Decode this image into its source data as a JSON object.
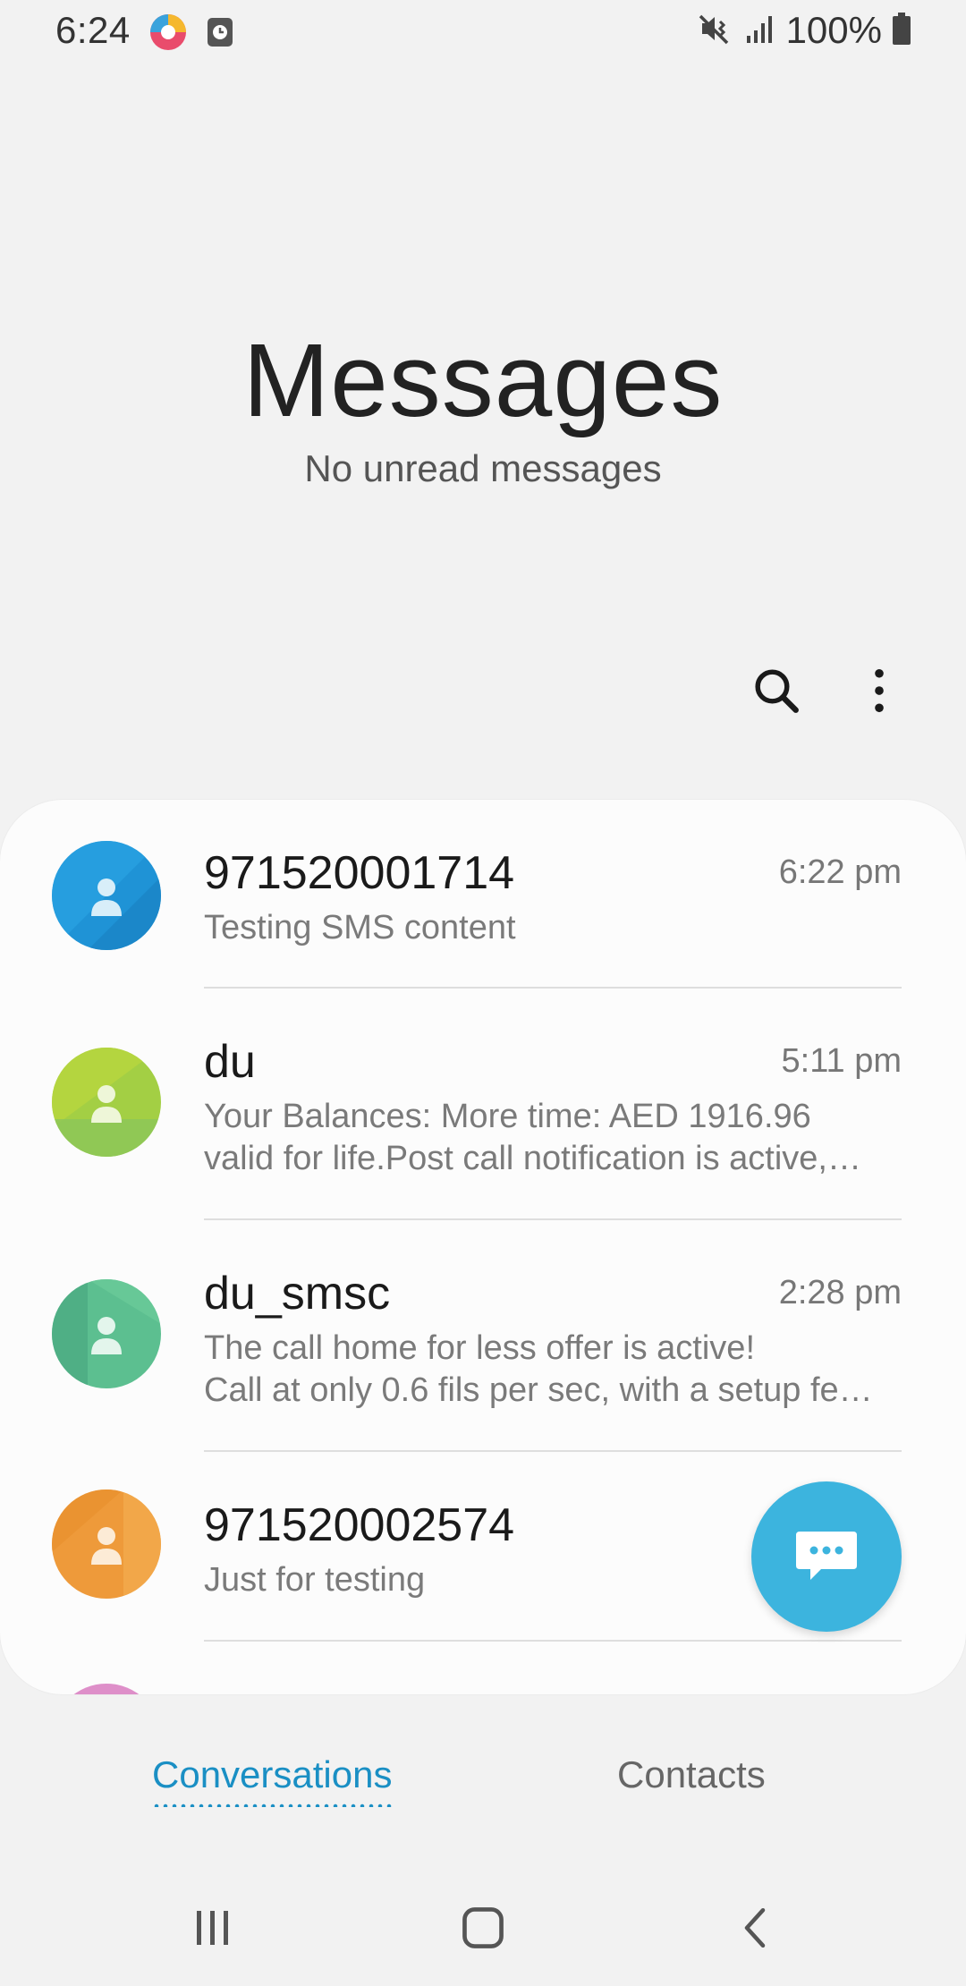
{
  "status_bar": {
    "time": "6:24",
    "battery_text": "100%",
    "icons": [
      "app-notification-icon",
      "clock-app-icon",
      "mute-vibrate-icon",
      "signal-icon",
      "battery-icon"
    ]
  },
  "header": {
    "title": "Messages",
    "subtitle": "No unread messages"
  },
  "toolbar": {
    "icons": [
      "search-icon",
      "more-options-icon"
    ]
  },
  "conversations": [
    {
      "name": "971520001714",
      "time": "6:22 pm",
      "preview_lines": [
        "Testing SMS content"
      ],
      "avatar_color": "#1f93d6"
    },
    {
      "name": "du",
      "time": "5:11 pm",
      "preview_lines": [
        "Your Balances: More time: AED 1916.96",
        "valid for life.Post call notification is active,…"
      ],
      "avatar_color": "#a3cf44"
    },
    {
      "name": "du_smsc",
      "time": "2:28 pm",
      "preview_lines": [
        "The call home for less offer is active!",
        "Call at only 0.6 fils per sec, with a setup fe…"
      ],
      "avatar_color": "#5cbf90"
    },
    {
      "name": "971520002574",
      "time": "",
      "preview_lines": [
        "Just for testing"
      ],
      "avatar_color": "#ee9a3a"
    }
  ],
  "fab": {
    "icon": "compose-message-icon"
  },
  "bottom_tabs": [
    {
      "label": "Conversations",
      "active": true
    },
    {
      "label": "Contacts",
      "active": false
    }
  ],
  "nav_bar": {
    "icons": [
      "recents-icon",
      "home-icon",
      "back-icon"
    ]
  },
  "colors": {
    "accent": "#1a8fc4",
    "fab": "#3cb4de",
    "background": "#f2f2f2",
    "card": "#fcfcfc"
  }
}
